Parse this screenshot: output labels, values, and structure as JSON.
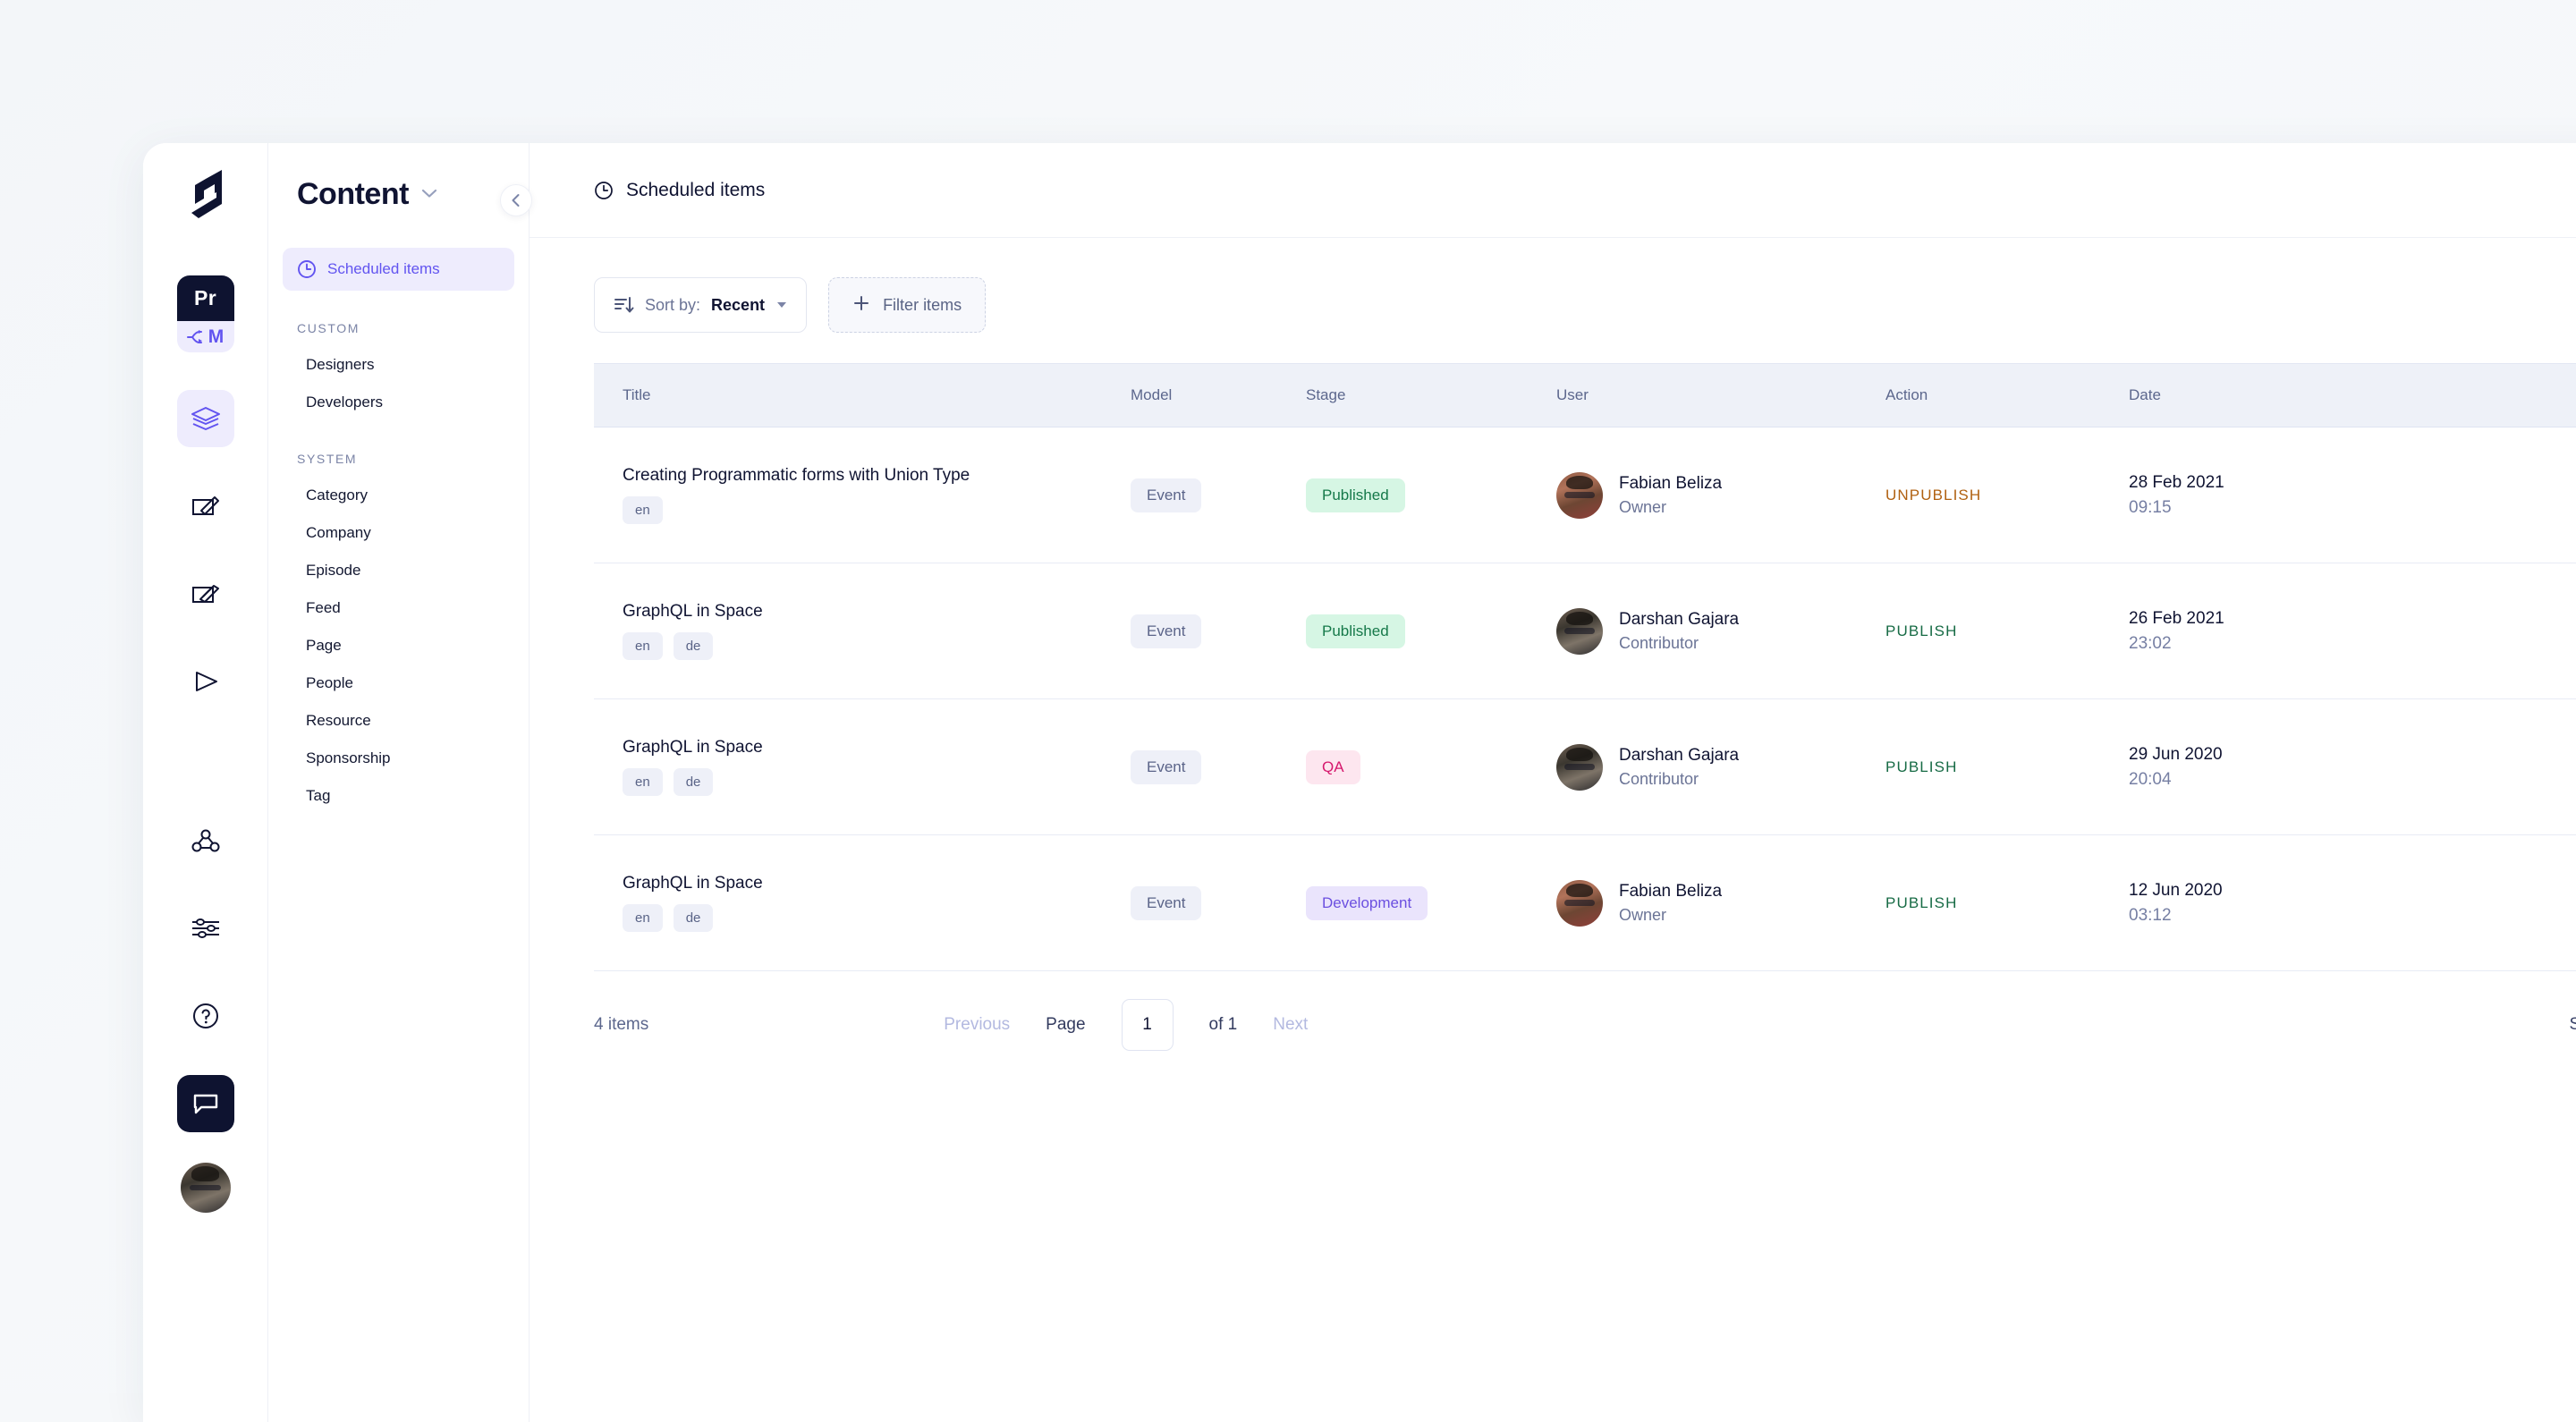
{
  "rail": {
    "logo_icon": "graphcms-logo-icon",
    "project_badge": {
      "top": "Pr",
      "bottom_letter": "M",
      "bottom_icon": "branch-merge-icon"
    },
    "items": [
      {
        "name": "schema-layers-icon",
        "active": true
      },
      {
        "name": "content-edit-icon",
        "active": false
      },
      {
        "name": "assets-edit-icon",
        "active": false
      },
      {
        "name": "play-run-icon",
        "active": false
      },
      {
        "name": "webhooks-icon",
        "active": false
      },
      {
        "name": "settings-sliders-icon",
        "active": false
      },
      {
        "name": "help-question-icon",
        "active": false
      },
      {
        "name": "chat-support-icon",
        "active": false
      }
    ],
    "user_avatar": "user-avatar"
  },
  "sidebar": {
    "title": "Content",
    "dropdown_icon": "chevron-down-icon",
    "collapse_icon": "chevron-left-icon",
    "active_item": {
      "label": "Scheduled items",
      "icon": "clock-icon"
    },
    "groups": [
      {
        "label": "CUSTOM",
        "items": [
          "Designers",
          "Developers"
        ]
      },
      {
        "label": "SYSTEM",
        "items": [
          "Category",
          "Company",
          "Episode",
          "Feed",
          "Page",
          "People",
          "Resource",
          "Sponsorship",
          "Tag"
        ]
      }
    ]
  },
  "main": {
    "header": {
      "title": "Scheduled items",
      "icon": "clock-icon"
    },
    "toolbar": {
      "sort_icon": "sort-descending-icon",
      "sort_label": "Sort by:",
      "sort_value": "Recent",
      "filter_icon": "plus-icon",
      "filter_label": "Filter items"
    },
    "table": {
      "columns": [
        "Title",
        "Model",
        "Stage",
        "User",
        "Action",
        "Date"
      ],
      "rows": [
        {
          "title": "Creating Programmatic forms with Union Type",
          "langs": [
            "en"
          ],
          "model": "Event",
          "stage": "Published",
          "stage_kind": "published",
          "user_name": "Fabian Beliza",
          "user_role": "Owner",
          "avatar": "face-a",
          "action": "UNPUBLISH",
          "action_kind": "unpublish",
          "date": "28 Feb 2021",
          "time": "09:15"
        },
        {
          "title": "GraphQL in Space",
          "langs": [
            "en",
            "de"
          ],
          "model": "Event",
          "stage": "Published",
          "stage_kind": "published",
          "user_name": "Darshan Gajara",
          "user_role": "Contributor",
          "avatar": "face-b",
          "action": "PUBLISH",
          "action_kind": "publish",
          "date": "26 Feb 2021",
          "time": "23:02"
        },
        {
          "title": "GraphQL in Space",
          "langs": [
            "en",
            "de"
          ],
          "model": "Event",
          "stage": "QA",
          "stage_kind": "qa",
          "user_name": "Darshan Gajara",
          "user_role": "Contributor",
          "avatar": "face-b",
          "action": "PUBLISH",
          "action_kind": "publish",
          "date": "29 Jun 2020",
          "time": "20:04"
        },
        {
          "title": "GraphQL in Space",
          "langs": [
            "en",
            "de"
          ],
          "model": "Event",
          "stage": "Development",
          "stage_kind": "development",
          "user_name": "Fabian Beliza",
          "user_role": "Owner",
          "avatar": "face-a",
          "action": "PUBLISH",
          "action_kind": "publish",
          "date": "12 Jun 2020",
          "time": "03:12"
        }
      ]
    },
    "footer": {
      "items_count": "4 items",
      "previous": "Previous",
      "page_label": "Page",
      "page_value": "1",
      "of_label": "of 1",
      "next": "Next",
      "show_label": "Show"
    }
  },
  "colors": {
    "accent": "#6254f0",
    "accent_soft": "#eeecfd",
    "ink": "#101432",
    "muted": "#6b7496",
    "published_bg": "#d6f6e4",
    "published_fg": "#16794a",
    "qa_bg": "#fde6ef",
    "qa_fg": "#d6186d",
    "development_bg": "#eae4fc",
    "development_fg": "#6b4fe0",
    "publish_fg": "#176b45",
    "unpublish_fg": "#b06010"
  }
}
